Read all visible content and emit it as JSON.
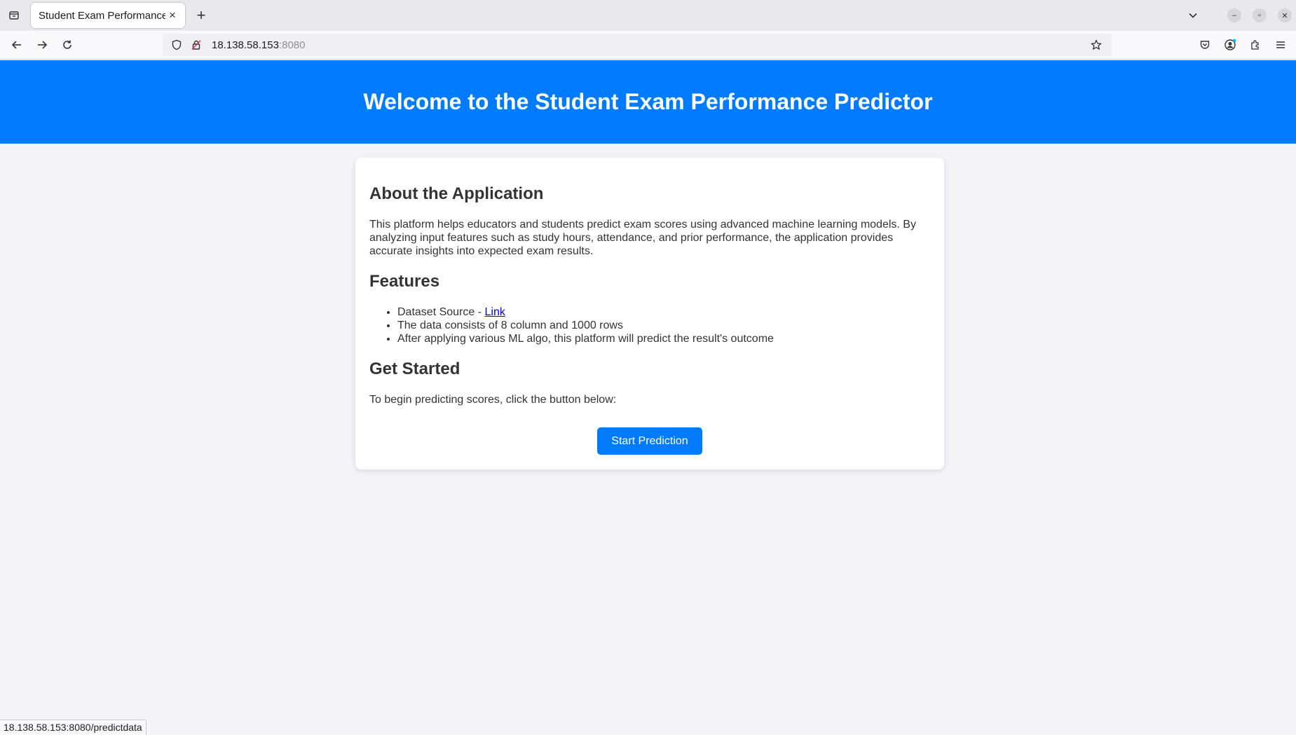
{
  "browser": {
    "tab_title": "Student Exam Performance",
    "url_host": "18.138.58.153",
    "url_port": ":8080",
    "status_url": "18.138.58.153:8080/predictdata"
  },
  "hero": {
    "title": "Welcome to the Student Exam Performance Predictor"
  },
  "about": {
    "heading": "About the Application",
    "text": "This platform helps educators and students predict exam scores using advanced machine learning models. By analyzing input features such as study hours, attendance, and prior performance, the application provides accurate insights into expected exam results."
  },
  "features": {
    "heading": "Features",
    "dataset_prefix": "Dataset Source - ",
    "dataset_link": "Link",
    "item2": "The data consists of 8 column and 1000 rows",
    "item3": "After applying various ML algo, this platform will predict the result's outcome"
  },
  "get_started": {
    "heading": "Get Started",
    "text": "To begin predicting scores, click the button below:",
    "button": "Start Prediction"
  },
  "colors": {
    "accent": "#007bff",
    "background": "#f4f4f8",
    "text": "#333333",
    "link": "#0000ee"
  }
}
